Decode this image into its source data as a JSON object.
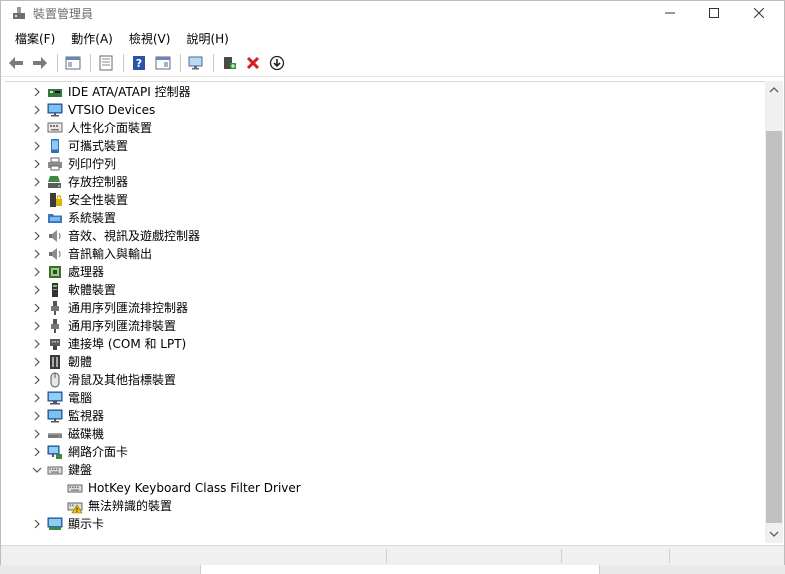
{
  "window": {
    "title": "裝置管理員",
    "min_glyph": "—",
    "max_glyph": "☐",
    "close_glyph": "✕"
  },
  "menu": [
    {
      "label": "檔案(F)"
    },
    {
      "label": "動作(A)"
    },
    {
      "label": "檢視(V)"
    },
    {
      "label": "說明(H)"
    }
  ],
  "toolbar": [
    {
      "icon": "back-arrow-icon"
    },
    {
      "icon": "forward-arrow-icon"
    },
    {
      "icon": "show-hide-tree-icon"
    },
    {
      "icon": "properties-icon"
    },
    {
      "icon": "help-icon"
    },
    {
      "icon": "view-icon"
    },
    {
      "icon": "monitor-scan-icon"
    },
    {
      "icon": "add-driver-icon"
    },
    {
      "icon": "uninstall-icon"
    },
    {
      "icon": "update-driver-icon"
    }
  ],
  "tree": [
    {
      "label": "IDE ATA/ATAPI 控制器",
      "icon": "ide-controller-icon",
      "expanded": false,
      "level": 0
    },
    {
      "label": "VTSIO Devices",
      "icon": "monitor-icon",
      "expanded": false,
      "level": 0
    },
    {
      "label": "人性化介面裝置",
      "icon": "hid-icon",
      "expanded": false,
      "level": 0
    },
    {
      "label": "可攜式裝置",
      "icon": "portable-device-icon",
      "expanded": false,
      "level": 0
    },
    {
      "label": "列印佇列",
      "icon": "printer-icon",
      "expanded": false,
      "level": 0
    },
    {
      "label": "存放控制器",
      "icon": "storage-controller-icon",
      "expanded": false,
      "level": 0
    },
    {
      "label": "安全性裝置",
      "icon": "security-device-icon",
      "expanded": false,
      "level": 0
    },
    {
      "label": "系統裝置",
      "icon": "system-folder-icon",
      "expanded": false,
      "level": 0
    },
    {
      "label": "音效、視訊及遊戲控制器",
      "icon": "speaker-icon",
      "expanded": false,
      "level": 0
    },
    {
      "label": "音訊輸入與輸出",
      "icon": "speaker-icon",
      "expanded": false,
      "level": 0
    },
    {
      "label": "處理器",
      "icon": "processor-icon",
      "expanded": false,
      "level": 0
    },
    {
      "label": "軟體裝置",
      "icon": "software-device-icon",
      "expanded": false,
      "level": 0
    },
    {
      "label": "通用序列匯流排控制器",
      "icon": "usb-icon",
      "expanded": false,
      "level": 0
    },
    {
      "label": "通用序列匯流排裝置",
      "icon": "usb-icon",
      "expanded": false,
      "level": 0
    },
    {
      "label": "連接埠 (COM 和 LPT)",
      "icon": "port-icon",
      "expanded": false,
      "level": 0
    },
    {
      "label": "韌體",
      "icon": "firmware-icon",
      "expanded": false,
      "level": 0
    },
    {
      "label": "滑鼠及其他指標裝置",
      "icon": "mouse-icon",
      "expanded": false,
      "level": 0
    },
    {
      "label": "電腦",
      "icon": "computer-icon",
      "expanded": false,
      "level": 0
    },
    {
      "label": "監視器",
      "icon": "monitor-icon",
      "expanded": false,
      "level": 0
    },
    {
      "label": "磁碟機",
      "icon": "disk-drive-icon",
      "expanded": false,
      "level": 0
    },
    {
      "label": "網路介面卡",
      "icon": "network-adapter-icon",
      "expanded": false,
      "level": 0
    },
    {
      "label": "鍵盤",
      "icon": "keyboard-icon",
      "expanded": true,
      "level": 0
    },
    {
      "label": "HotKey Keyboard Class Filter Driver",
      "icon": "keyboard-icon",
      "leaf": true,
      "level": 1
    },
    {
      "label": "無法辨識的裝置",
      "icon": "keyboard-warning-icon",
      "leaf": true,
      "level": 1
    },
    {
      "label": "顯示卡",
      "icon": "display-adapter-icon",
      "expanded": false,
      "level": 0
    }
  ],
  "colors": {
    "accent_blue": "#2a73c9",
    "warning_yellow": "#f2c200",
    "delete_red": "#d21f1f",
    "add_green": "#2f9a2f"
  }
}
